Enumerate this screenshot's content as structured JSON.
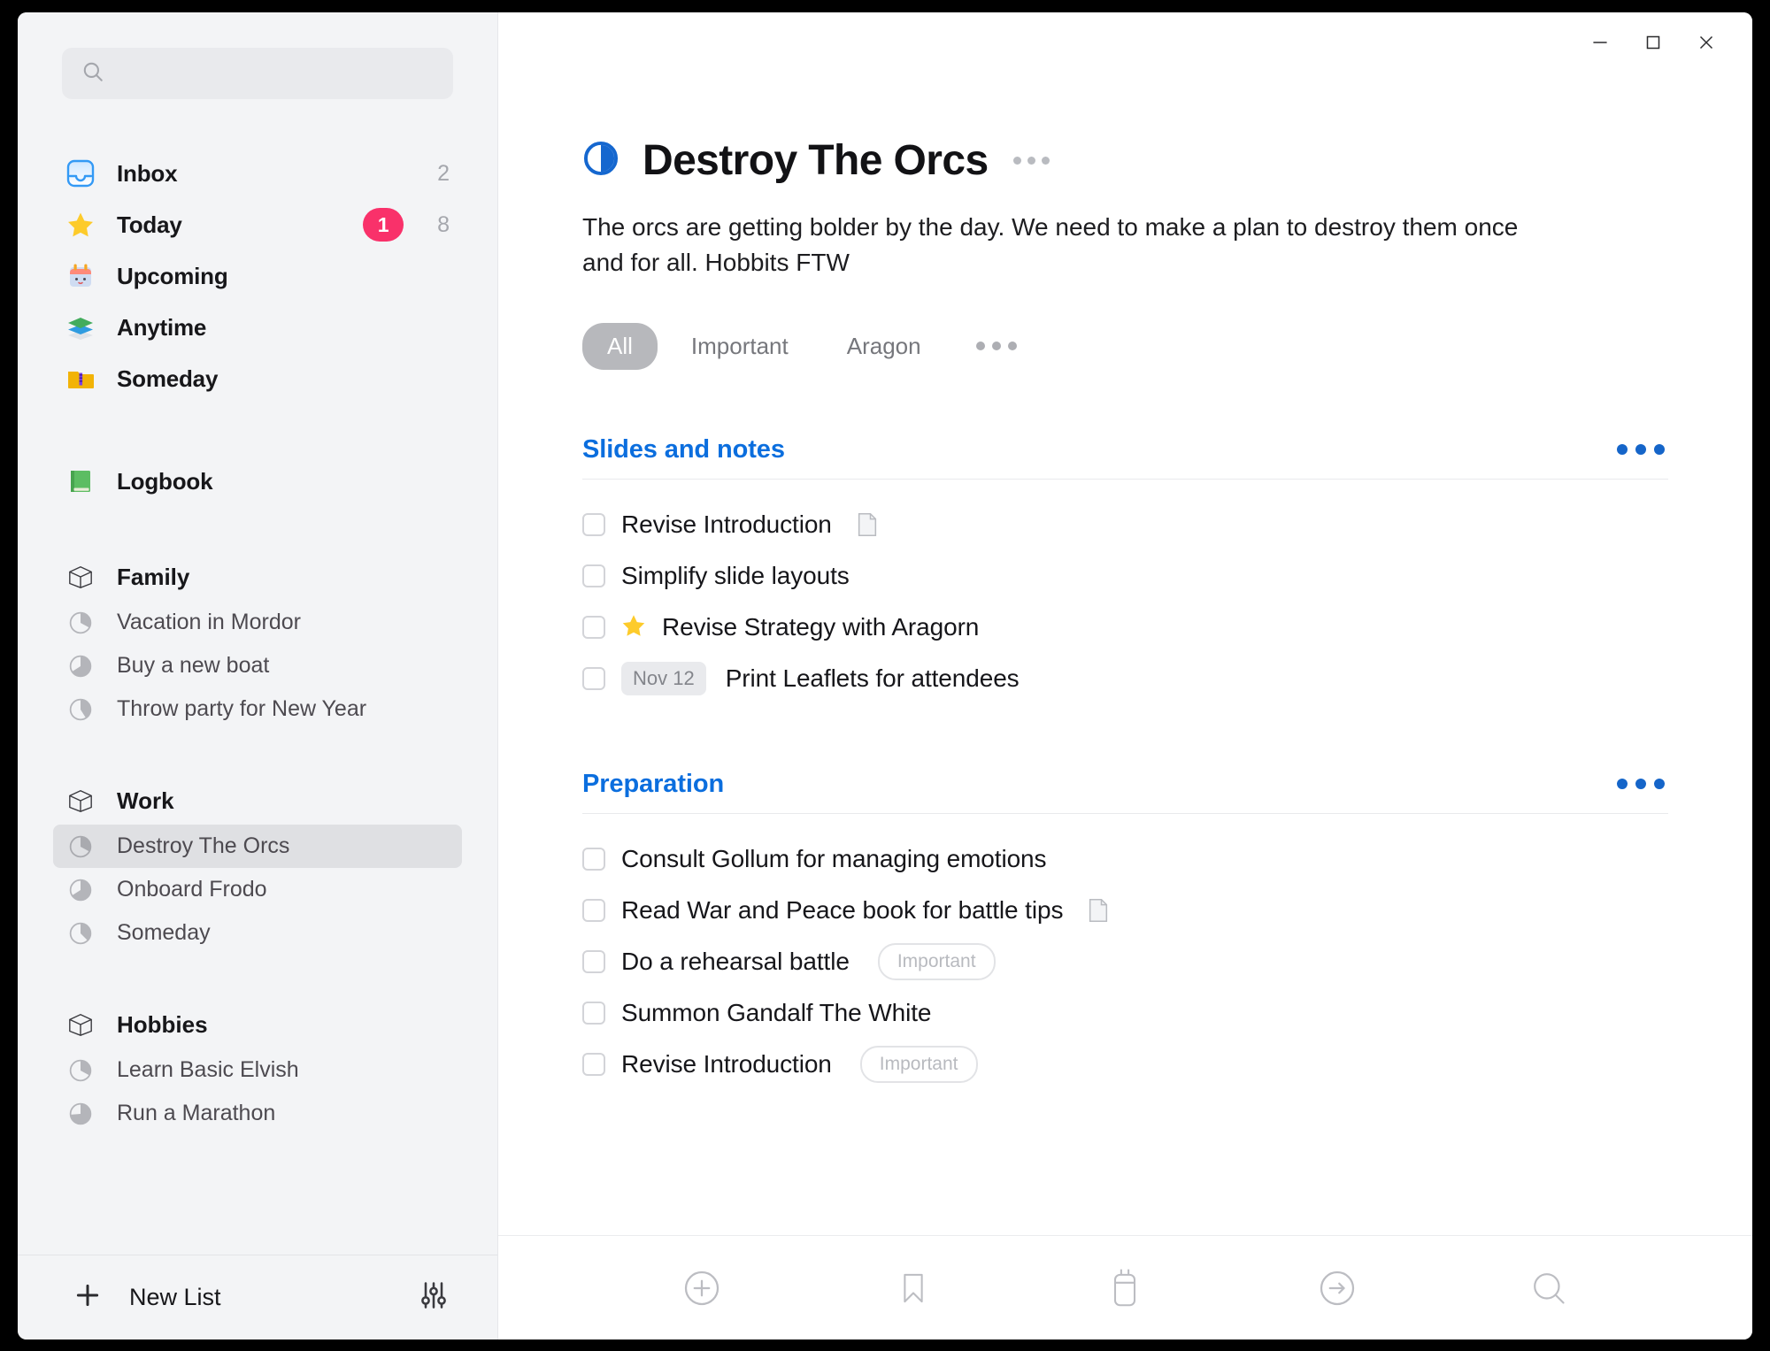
{
  "window": {
    "controls": {
      "minimize": "minimize",
      "maximize": "maximize",
      "close": "close"
    }
  },
  "sidebar": {
    "search": {
      "value": "",
      "placeholder": ""
    },
    "nav": [
      {
        "id": "inbox",
        "label": "Inbox",
        "icon": "inbox-tray-icon",
        "count": "2",
        "badge": ""
      },
      {
        "id": "today",
        "label": "Today",
        "icon": "star-icon",
        "count": "8",
        "badge": "1"
      },
      {
        "id": "upcoming",
        "label": "Upcoming",
        "icon": "calendar-icon",
        "count": "",
        "badge": ""
      },
      {
        "id": "anytime",
        "label": "Anytime",
        "icon": "layers-icon",
        "count": "",
        "badge": ""
      },
      {
        "id": "someday",
        "label": "Someday",
        "icon": "archive-box-icon",
        "count": "",
        "badge": ""
      },
      {
        "id": "logbook",
        "label": "Logbook",
        "icon": "green-book-icon",
        "count": "",
        "badge": ""
      }
    ],
    "groups": [
      {
        "name": "Family",
        "icon": "open-box-icon",
        "projects": [
          {
            "label": "Vacation in Mordor",
            "progress": 15,
            "selected": false
          },
          {
            "label": "Buy a new boat",
            "progress": 55,
            "selected": false
          },
          {
            "label": "Throw party for New Year",
            "progress": 40,
            "selected": false
          }
        ]
      },
      {
        "name": "Work",
        "icon": "open-box-icon",
        "projects": [
          {
            "label": "Destroy The Orcs",
            "progress": 15,
            "selected": true
          },
          {
            "label": "Onboard Frodo",
            "progress": 55,
            "selected": false
          },
          {
            "label": "Someday",
            "progress": 30,
            "selected": false
          }
        ]
      },
      {
        "name": "Hobbies",
        "icon": "open-box-icon",
        "projects": [
          {
            "label": "Learn Basic Elvish",
            "progress": 15,
            "selected": false
          },
          {
            "label": "Run a Marathon",
            "progress": 50,
            "selected": false
          }
        ]
      }
    ],
    "footer": {
      "new_list_label": "New List",
      "new_list_icon": "plus-icon",
      "settings_icon": "sliders-icon"
    }
  },
  "main": {
    "project": {
      "title": "Destroy The Orcs",
      "status_icon": "half-circle-progress-icon",
      "menu_icon": "more-horizontal-icon",
      "description": "The orcs are getting bolder by the day. We need to make a plan to destroy them once and for all. Hobbits FTW"
    },
    "filters": {
      "chips": [
        {
          "label": "All",
          "active": true
        },
        {
          "label": "Important",
          "active": false
        },
        {
          "label": "Aragon",
          "active": false
        }
      ],
      "more_icon": "more-horizontal-icon"
    },
    "sections": [
      {
        "title": "Slides and notes",
        "menu_icon": "more-horizontal-icon",
        "todos": [
          {
            "text": "Revise Introduction",
            "date": "",
            "star": false,
            "note": true,
            "tag": ""
          },
          {
            "text": "Simplify slide layouts",
            "date": "",
            "star": false,
            "note": false,
            "tag": ""
          },
          {
            "text": "Revise Strategy with Aragorn",
            "date": "",
            "star": true,
            "note": false,
            "tag": ""
          },
          {
            "text": "Print Leaflets for attendees",
            "date": "Nov 12",
            "star": false,
            "note": false,
            "tag": ""
          }
        ]
      },
      {
        "title": "Preparation",
        "menu_icon": "more-horizontal-icon",
        "todos": [
          {
            "text": "Consult Gollum for managing emotions",
            "date": "",
            "star": false,
            "note": false,
            "tag": ""
          },
          {
            "text": "Read War and Peace book for battle tips",
            "date": "",
            "star": false,
            "note": true,
            "tag": ""
          },
          {
            "text": "Do a rehearsal battle",
            "date": "",
            "star": false,
            "note": false,
            "tag": "Important"
          },
          {
            "text": "Summon Gandalf The White",
            "date": "",
            "star": false,
            "note": false,
            "tag": ""
          },
          {
            "text": "Revise Introduction",
            "date": "",
            "star": false,
            "note": false,
            "tag": "Important"
          }
        ]
      }
    ],
    "toolbar": [
      {
        "id": "new-todo",
        "icon": "plus-circle-icon"
      },
      {
        "id": "bookmark",
        "icon": "bookmark-icon"
      },
      {
        "id": "schedule",
        "icon": "calendar-icon"
      },
      {
        "id": "move",
        "icon": "arrow-right-circle-icon"
      },
      {
        "id": "search",
        "icon": "search-icon"
      }
    ]
  },
  "colors": {
    "accent_blue": "#0b6ede",
    "badge_pink": "#f9316a",
    "sidebar_bg": "#f3f4f6",
    "selected_row": "#dfe0e3"
  }
}
